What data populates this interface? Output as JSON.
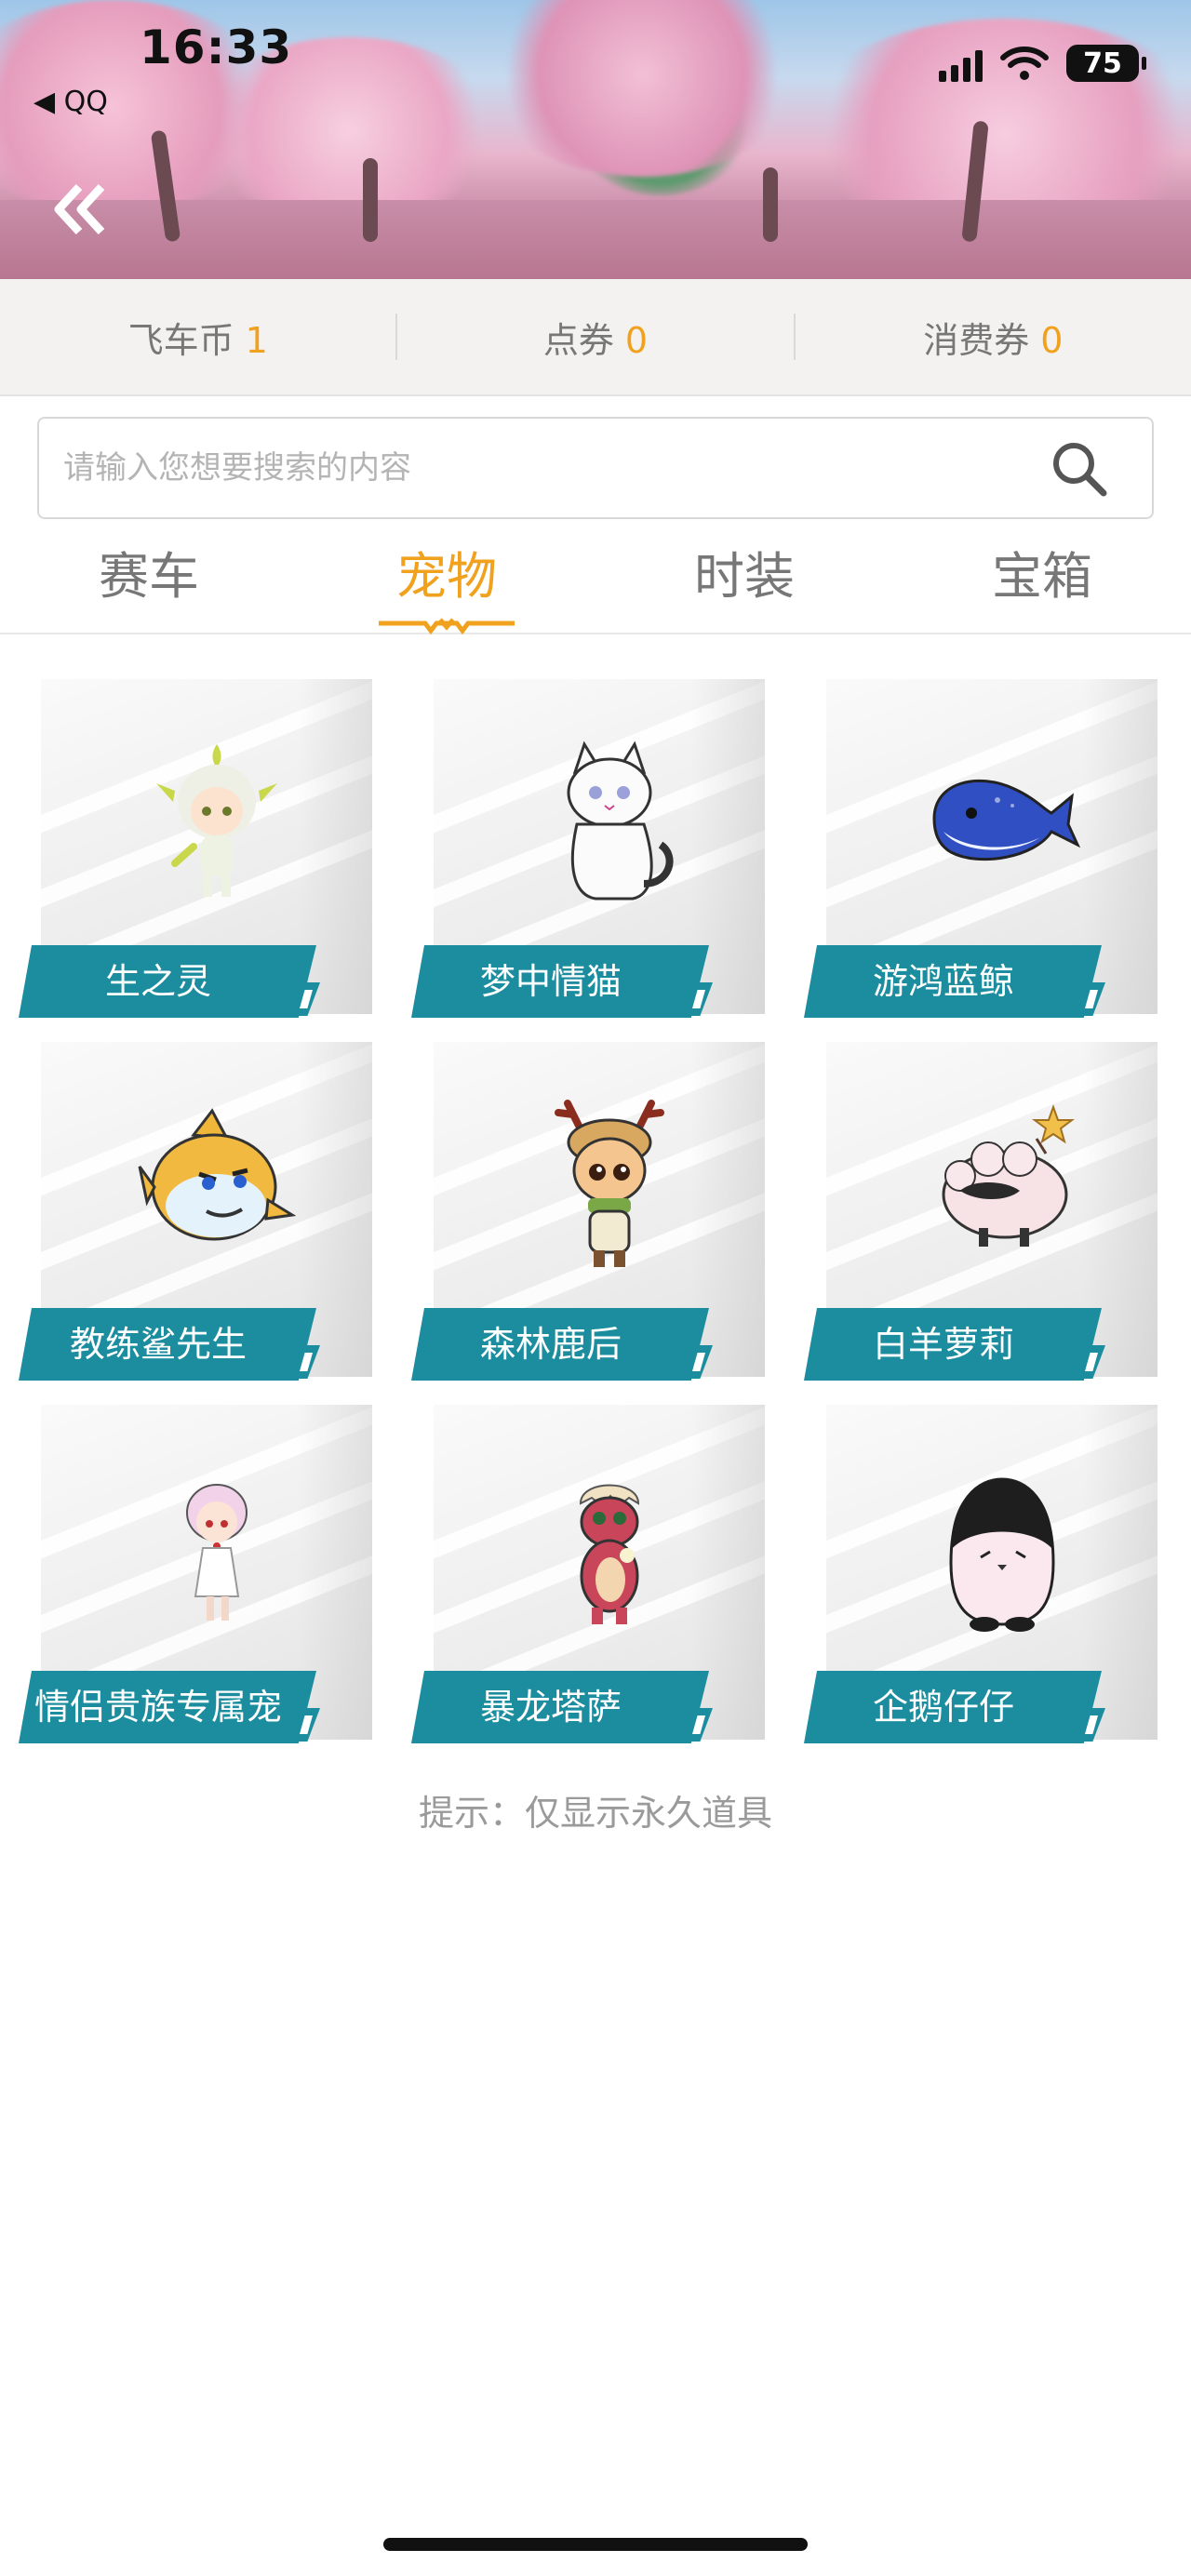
{
  "status_bar": {
    "time": "16:33",
    "back_app": "◀ QQ",
    "battery": "75"
  },
  "currency": [
    {
      "label": "飞车币",
      "value": "1"
    },
    {
      "label": "点券",
      "value": "0"
    },
    {
      "label": "消费券",
      "value": "0"
    }
  ],
  "search": {
    "placeholder": "请输入您想要搜索的内容"
  },
  "tabs": [
    {
      "label": "赛车",
      "active": false
    },
    {
      "label": "宠物",
      "active": true
    },
    {
      "label": "时装",
      "active": false
    },
    {
      "label": "宝箱",
      "active": false
    }
  ],
  "pets": [
    {
      "name": "生之灵",
      "icon": "sprite-spirit-icon"
    },
    {
      "name": "梦中情猫",
      "icon": "white-cat-icon"
    },
    {
      "name": "游鸿蓝鲸",
      "icon": "blue-whale-icon"
    },
    {
      "name": "教练鲨先生",
      "icon": "shark-icon"
    },
    {
      "name": "森林鹿后",
      "icon": "deer-girl-icon"
    },
    {
      "name": "白羊萝莉",
      "icon": "sheep-icon"
    },
    {
      "name": "情侣贵族专属宠",
      "icon": "couple-pet-icon"
    },
    {
      "name": "暴龙塔萨",
      "icon": "dinosaur-icon"
    },
    {
      "name": "企鹅仔仔",
      "icon": "penguin-icon"
    }
  ],
  "hint": "提示：仅显示永久道具",
  "colors": {
    "accent": "#f0a11e",
    "label_teal": "#1b8d9e"
  }
}
